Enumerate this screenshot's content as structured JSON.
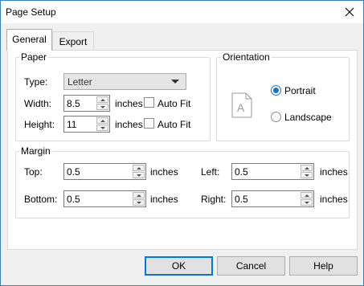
{
  "window": {
    "title": "Page Setup"
  },
  "tabs": [
    {
      "label": "General",
      "active": true
    },
    {
      "label": "Export",
      "active": false
    }
  ],
  "paper": {
    "group_label": "Paper",
    "type_label": "Type:",
    "type_value": "Letter",
    "width_label": "Width:",
    "width_value": "8.5",
    "width_unit": "inches",
    "width_autofit": "Auto Fit",
    "height_label": "Height:",
    "height_value": "11",
    "height_unit": "inches",
    "height_autofit": "Auto Fit"
  },
  "orientation": {
    "group_label": "Orientation",
    "portrait_label": "Portrait",
    "landscape_label": "Landscape",
    "selected": "Portrait",
    "icon_letter": "A"
  },
  "margin": {
    "group_label": "Margin",
    "top_label": "Top:",
    "top_value": "0.5",
    "bottom_label": "Bottom:",
    "bottom_value": "0.5",
    "left_label": "Left:",
    "left_value": "0.5",
    "right_label": "Right:",
    "right_value": "0.5",
    "unit": "inches"
  },
  "buttons": {
    "ok": "OK",
    "cancel": "Cancel",
    "help": "Help"
  },
  "colors": {
    "accent": "#0078d7",
    "radio": "#1a73c9",
    "window_border": "#3c7fb1"
  }
}
